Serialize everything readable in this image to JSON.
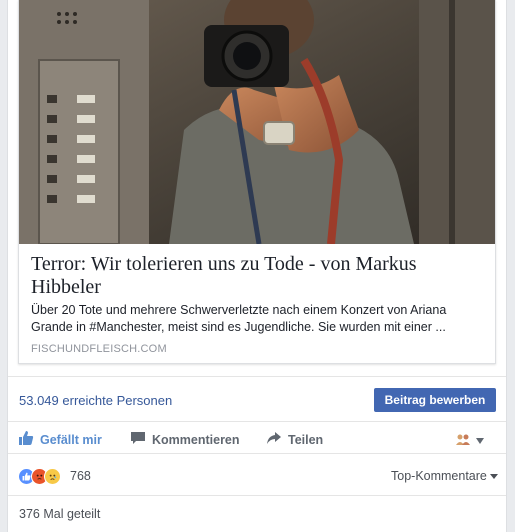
{
  "link_preview": {
    "title": "Terror: Wir tolerieren uns zu Tode - von Markus Hibbeler",
    "description": "Über 20 Tote und mehrere Schwerverletzte nach einem Konzert von Ariana Grande in #Manchester, meist sind es Jugendliche. Sie wurden mit einer ...",
    "domain": "FISCHUNDFLEISCH.COM"
  },
  "reach": {
    "count": "53.049",
    "label": "erreichte Personen",
    "promote_label": "Beitrag bewerben"
  },
  "actions": {
    "like": "Gefällt mir",
    "comment": "Kommentieren",
    "share": "Teilen"
  },
  "reactions": {
    "count": "768",
    "sort_label": "Top-Kommentare"
  },
  "shares": {
    "label": "376 Mal geteilt"
  },
  "colors": {
    "brand_blue": "#4267b2",
    "like_blue": "#598dcf",
    "link_blue": "#365899"
  },
  "icons": [
    "like-icon",
    "comment-icon",
    "share-icon",
    "audience-icon",
    "chevron-down-icon",
    "like-reaction-icon",
    "angry-reaction-icon",
    "sad-reaction-icon"
  ]
}
